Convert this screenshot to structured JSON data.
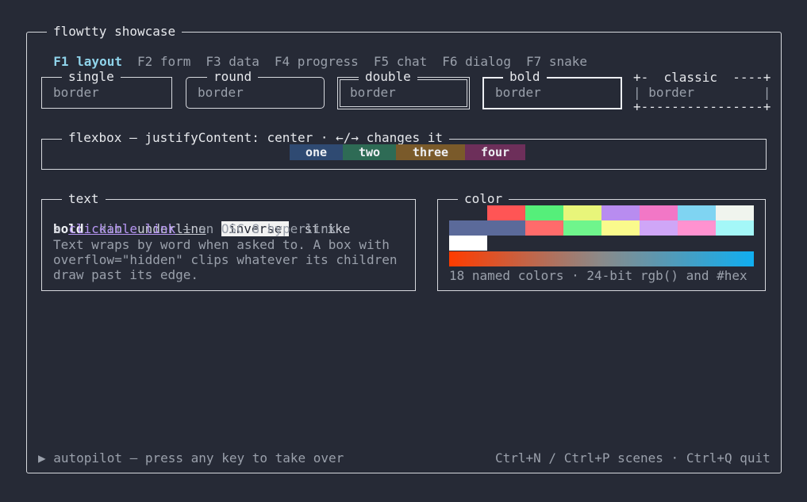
{
  "window": {
    "title": "flowtty showcase"
  },
  "tabs": [
    {
      "label": "F1 layout",
      "active": true
    },
    {
      "label": "F2 form",
      "active": false
    },
    {
      "label": "F3 data",
      "active": false
    },
    {
      "label": "F4 progress",
      "active": false
    },
    {
      "label": "F5 chat",
      "active": false
    },
    {
      "label": "F6 dialog",
      "active": false
    },
    {
      "label": "F7 snake",
      "active": false
    }
  ],
  "borders": {
    "single": {
      "title": "single",
      "text": "border"
    },
    "round": {
      "title": "round",
      "text": "border"
    },
    "double": {
      "title": "double",
      "text": "border"
    },
    "bold": {
      "title": "bold",
      "text": "border"
    },
    "classic": {
      "top": "+-  classic  ----+",
      "middle": "| border         |",
      "bottom": "+----------------+"
    }
  },
  "flexbox": {
    "title": "flexbox — justifyContent: center · ←/→ changes it",
    "items": [
      {
        "label": "one",
        "color": "#2f4a72"
      },
      {
        "label": "two",
        "color": "#2e6b55"
      },
      {
        "label": "three",
        "color": "#7a5a2a"
      },
      {
        "label": "four",
        "color": "#6d2f5a"
      }
    ]
  },
  "text_panel": {
    "title": "text",
    "bold": "bold",
    "dim": "dim",
    "underline": "underline",
    "inverse": "inverse",
    "strike": "strike",
    "line2_prefix": "a ",
    "link": "clickable link",
    "line2_suffix": " — an OSC 8 hyperlink",
    "wrap_lines": [
      "Text wraps by word when asked to. A box with",
      "overflow=\"hidden\" clips whatever its children",
      "draw past its edge."
    ]
  },
  "color_panel": {
    "title": "color",
    "row1": [
      "#262a36",
      "#ff5555",
      "#55ef7a",
      "#e8f57a",
      "#b88cf0",
      "#f277c6",
      "#7fd4f2",
      "#f0f4ee"
    ],
    "row2": [
      "#5b6a9a",
      "#5b6a9a",
      "#ff6b6b",
      "#6ff58c",
      "#fafa8c",
      "#cfa6f7",
      "#ff92d0",
      "#a4f7f8"
    ],
    "row3": [
      "#ffffff"
    ],
    "gradient": [
      "#ff3c00",
      "#8a8a8a",
      "#10aef0"
    ],
    "caption": "18 named colors · 24-bit rgb() and #hex"
  },
  "footer": {
    "left": "▶ autopilot — press any key to take over",
    "right": "Ctrl+N / Ctrl+P scenes · Ctrl+Q quit"
  }
}
